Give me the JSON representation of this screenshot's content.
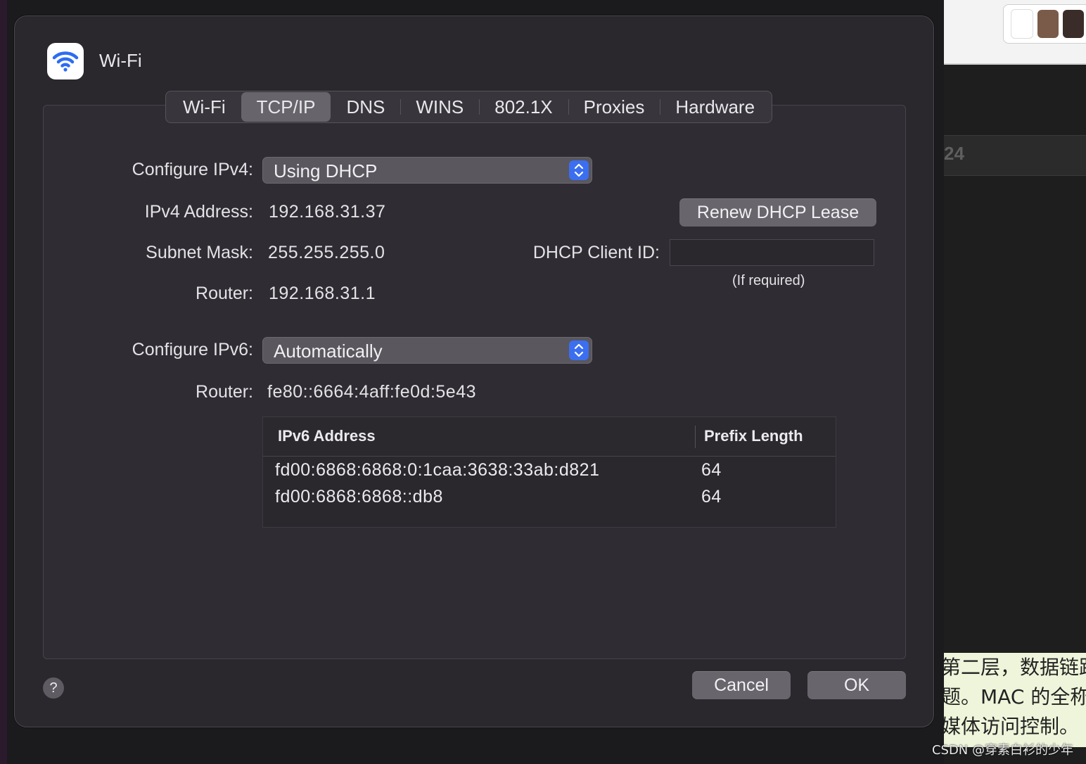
{
  "dialog": {
    "title": "Wi-Fi",
    "icon": "wifi-icon",
    "accent_color": "#3b6ff0"
  },
  "tabs": [
    {
      "label": "Wi-Fi",
      "active": false
    },
    {
      "label": "TCP/IP",
      "active": true
    },
    {
      "label": "DNS",
      "active": false
    },
    {
      "label": "WINS",
      "active": false
    },
    {
      "label": "802.1X",
      "active": false
    },
    {
      "label": "Proxies",
      "active": false
    },
    {
      "label": "Hardware",
      "active": false
    }
  ],
  "ipv4": {
    "configure_label": "Configure IPv4:",
    "configure_value": "Using DHCP",
    "address_label": "IPv4 Address:",
    "address_value": "192.168.31.37",
    "subnet_label": "Subnet Mask:",
    "subnet_value": "255.255.255.0",
    "router_label": "Router:",
    "router_value": "192.168.31.1",
    "renew_button": "Renew DHCP Lease",
    "client_id_label": "DHCP Client ID:",
    "client_id_value": "",
    "client_id_hint": "(If required)"
  },
  "ipv6": {
    "configure_label": "Configure IPv6:",
    "configure_value": "Automatically",
    "router_label": "Router:",
    "router_value": "fe80::6664:4aff:fe0d:5e43",
    "table": {
      "headers": [
        "IPv6 Address",
        "Prefix Length"
      ],
      "rows": [
        [
          "fd00:6868:6868:0:1caa:3638:33ab:d821",
          "64"
        ],
        [
          "fd00:6868:6868::db8",
          "64"
        ]
      ]
    }
  },
  "footer": {
    "help_label": "?",
    "cancel_button": "Cancel",
    "ok_button": "OK"
  },
  "background": {
    "partial_number": "24",
    "article_lines": [
      "第二层，数据链路",
      "题。MAC 的全称",
      "媒体访问控制。"
    ],
    "watermark": "CSDN @穿素白衫的少年"
  }
}
